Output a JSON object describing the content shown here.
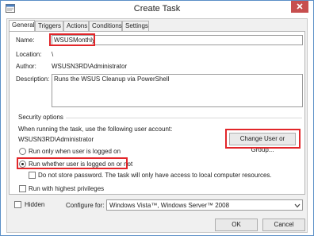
{
  "window": {
    "title": "Create Task",
    "close_icon": "close-icon",
    "app_icon": "task-scheduler-icon"
  },
  "tabs": [
    {
      "label": "General"
    },
    {
      "label": "Triggers"
    },
    {
      "label": "Actions"
    },
    {
      "label": "Conditions"
    },
    {
      "label": "Settings"
    }
  ],
  "general": {
    "name_label": "Name:",
    "name_value": "WSUSMonthly",
    "location_label": "Location:",
    "location_value": "\\",
    "author_label": "Author:",
    "author_value": "WSUSN3RD\\Administrator",
    "description_label": "Description:",
    "description_value": "Runs the WSUS Cleanup via PowerShell"
  },
  "security": {
    "group_label": "Security options",
    "account_prompt": "When running the task, use the following user account:",
    "account_value": "WSUSN3RD\\Administrator",
    "change_user_button": "Change User or Group...",
    "run_logged_on": "Run only when user is logged on",
    "run_whether": "Run whether user is logged on or not",
    "no_store_password": "Do not store password.  The task will only have access to local computer resources.",
    "highest_privileges": "Run with highest privileges"
  },
  "footer": {
    "hidden_label": "Hidden",
    "configure_label": "Configure for:",
    "configure_value": "Windows Vista™, Windows Server™ 2008",
    "ok_button": "OK",
    "cancel_button": "Cancel"
  },
  "colors": {
    "highlight": "#e2262a",
    "close_button": "#c74f4f",
    "window_border": "#5b8fc7"
  }
}
